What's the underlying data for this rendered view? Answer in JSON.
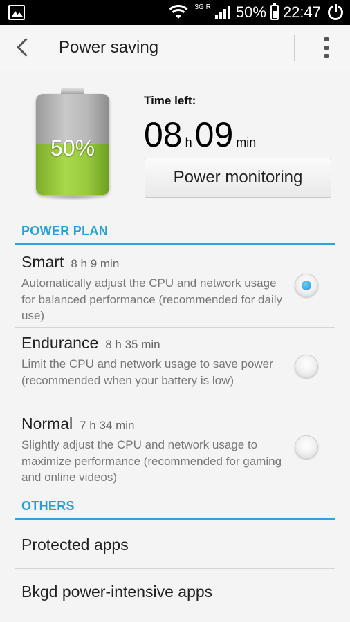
{
  "status_bar": {
    "network": "3G",
    "roaming": "R",
    "battery_percent": "50%",
    "time": "22:47",
    "icons": [
      "image-icon",
      "wifi-icon",
      "signal-icon",
      "battery-icon",
      "power-icon"
    ]
  },
  "action_bar": {
    "title": "Power saving",
    "icons": [
      "back-icon",
      "overflow-menu-icon"
    ]
  },
  "summary": {
    "battery_label": "50%",
    "battery_level": 0.5,
    "time_left_label": "Time left:",
    "hours": "08",
    "hours_unit": "h",
    "minutes": "09",
    "minutes_unit": "min",
    "power_monitoring_button": "Power monitoring"
  },
  "power_plan": {
    "section_title": "POWER PLAN",
    "plans": [
      {
        "name": "Smart",
        "time": "8 h 9 min",
        "desc": "Automatically adjust the CPU and network usage for balanced performance (recommended for daily use)",
        "selected": true
      },
      {
        "name": "Endurance",
        "time": "8 h 35 min",
        "desc": "Limit the CPU and network usage to save power (recommended when your battery is low)",
        "selected": false
      },
      {
        "name": "Normal",
        "time": "7 h 34 min",
        "desc": "Slightly adjust the CPU and network usage to maximize performance (recommended for gaming and online videos)",
        "selected": false
      }
    ]
  },
  "others": {
    "section_title": "OTHERS",
    "items": [
      "Protected apps",
      "Bkgd power-intensive apps"
    ]
  },
  "colors": {
    "accent": "#2aa4dc",
    "battery_green": "#98ca3e"
  }
}
